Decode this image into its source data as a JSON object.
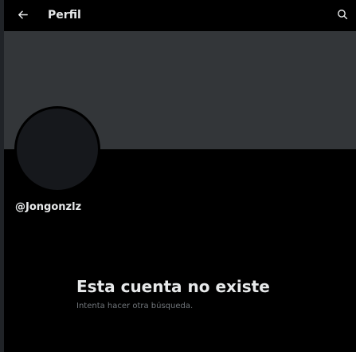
{
  "header": {
    "title": "Perfil",
    "back_icon": "arrow-left-icon",
    "search_icon": "search-icon"
  },
  "profile": {
    "handle": "@Jongonzlz"
  },
  "empty_state": {
    "title": "Esta cuenta no existe",
    "subtitle": "Intenta hacer otra búsqueda."
  },
  "colors": {
    "background": "#000000",
    "banner": "#333639",
    "avatar": "#16181c",
    "primary_text": "#e7e9ea",
    "secondary_text": "#71767b"
  }
}
